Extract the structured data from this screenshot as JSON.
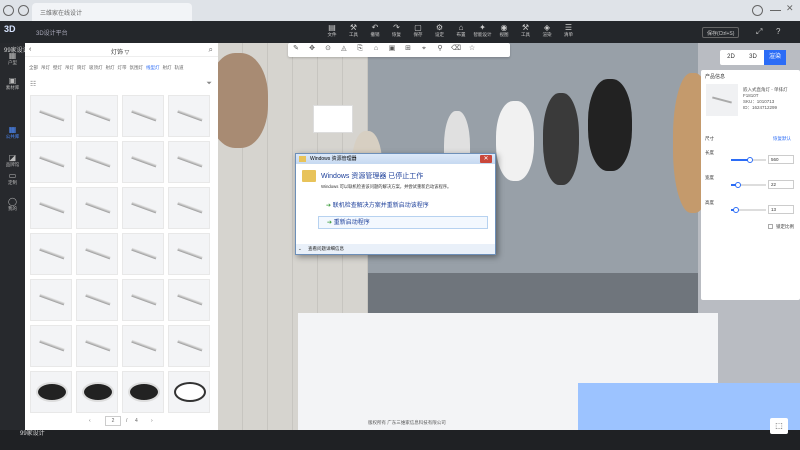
{
  "browser": {
    "tab_title": "三维家在线设计"
  },
  "app": {
    "logo": "3D",
    "platform": "3D设计平台"
  },
  "toolbar": {
    "tools": [
      {
        "label": "文件",
        "icon": "file-icon"
      },
      {
        "label": "工具",
        "icon": "tools-icon"
      },
      {
        "label": "撤销",
        "icon": "undo-icon"
      },
      {
        "label": "恢复",
        "icon": "redo-icon"
      },
      {
        "label": "保存",
        "icon": "save-icon"
      },
      {
        "label": "设定",
        "icon": "settings-icon"
      },
      {
        "label": "布置",
        "icon": "layout-icon"
      },
      {
        "label": "智能设计",
        "icon": "smart-design-icon"
      },
      {
        "label": "视图",
        "icon": "view-icon"
      },
      {
        "label": "工具",
        "icon": "tools2-icon"
      },
      {
        "label": "渲染",
        "icon": "render-icon"
      },
      {
        "label": "清单",
        "icon": "list-icon"
      }
    ],
    "right_button": "保存(Ctrl+S)"
  },
  "leftnav": {
    "items": [
      {
        "label": "户型",
        "icon": "floorplan-icon"
      },
      {
        "label": "素材库",
        "icon": "library-icon"
      },
      {
        "label": "公共库",
        "icon": "public-library-icon"
      },
      {
        "label": "品牌馆",
        "icon": "brand-icon"
      },
      {
        "label": "定制",
        "icon": "custom-icon"
      },
      {
        "label": "我的",
        "icon": "user-icon"
      }
    ]
  },
  "library": {
    "title": "灯饰 ▽",
    "categories": [
      "全部",
      "吊灯",
      "壁灯",
      "吊灯",
      "筒灯",
      "吸顶灯",
      "射灯",
      "灯带",
      "氛围灯",
      "线型灯",
      "射灯",
      "轨道"
    ],
    "active_category": "线型灯",
    "page": {
      "prev": "‹",
      "current": "2",
      "sep": "/",
      "total": "4",
      "next": "›"
    }
  },
  "scene_toolbar": [
    "✎",
    "✥",
    "⊙",
    "◬",
    "⎘",
    "⌂",
    "▣",
    "⊞",
    "⌖",
    "⚲",
    "⌫",
    "☆"
  ],
  "view_switch": {
    "d2": "2D",
    "d3": "3D",
    "render": "渲染"
  },
  "right_panel": {
    "title": "产品信息",
    "name": "嵌入式直角灯 - 单排灯 F1810T",
    "code": "SKU：1010713",
    "size": "ID：1624712299",
    "section": "尺寸",
    "apply_all": "恢复默认",
    "fields": [
      {
        "label": "长度",
        "value": "560",
        "fill": 0.55
      },
      {
        "label": "宽度",
        "value": "22",
        "fill": 0.2
      },
      {
        "label": "高度",
        "value": "13",
        "fill": 0.15
      }
    ],
    "lock_label": "锁定比例"
  },
  "dialog": {
    "title": "Windows 资源管理器",
    "heading": "Windows 资源管理器 已停止工作",
    "description": "Windows 可以联机检查该问题的解决方案，并尝试重新启动该程序。",
    "option1": "联机检查解决方案并重新启动该程序",
    "option2": "重新启动程序",
    "footer": "查看问题详细信息",
    "close": "✕"
  },
  "footer_note": "版权所有 广东三维家信息科技有限公司",
  "watermarks": [
    "99家设计",
    "99家设计"
  ]
}
